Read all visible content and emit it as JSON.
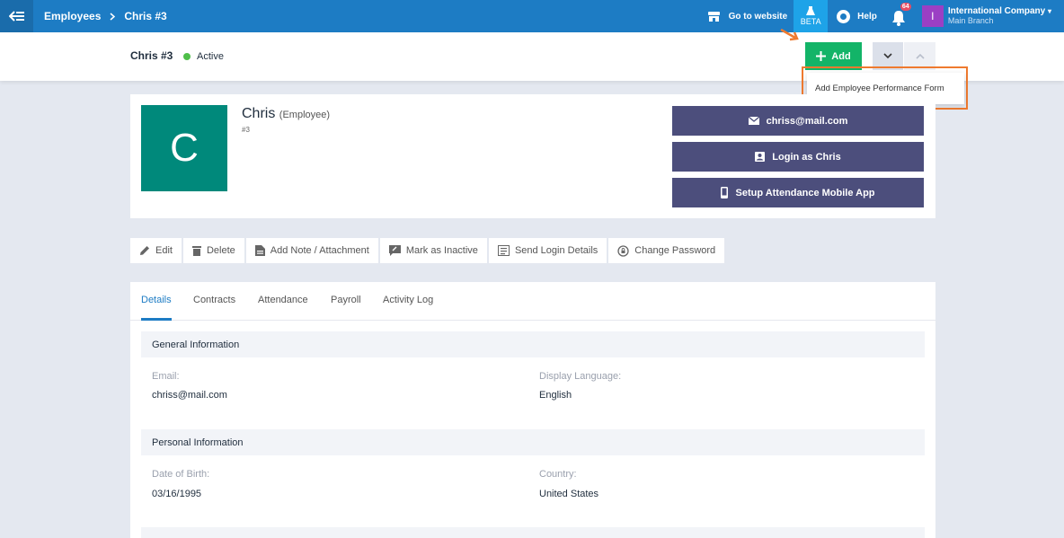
{
  "topbar": {
    "breadcrumb_parent": "Employees",
    "breadcrumb_current": "Chris #3",
    "go_to_website": "Go to website",
    "beta": "BETA",
    "help": "Help",
    "notification_count": "64",
    "company_initial": "I",
    "company_name": "International Company",
    "company_branch": "Main Branch"
  },
  "header": {
    "title": "Chris #3",
    "status": "Active",
    "add_label": "Add",
    "dropdown_item": "Add Employee Performance Form"
  },
  "profile": {
    "avatar_letter": "C",
    "name": "Chris",
    "role": "(Employee)",
    "number": "#3",
    "email_button": "chriss@mail.com",
    "login_button": "Login as Chris",
    "setup_button": "Setup Attendance Mobile App"
  },
  "toolbar": {
    "edit": "Edit",
    "delete": "Delete",
    "add_note": "Add Note / Attachment",
    "mark_inactive": "Mark as Inactive",
    "send_login": "Send Login Details",
    "change_password": "Change Password"
  },
  "tabs": [
    "Details",
    "Contracts",
    "Attendance",
    "Payroll",
    "Activity Log"
  ],
  "details": {
    "general_heading": "General Information",
    "email_label": "Email:",
    "email_value": "chriss@mail.com",
    "language_label": "Display Language:",
    "language_value": "English",
    "personal_heading": "Personal Information",
    "dob_label": "Date of Birth:",
    "dob_value": "03/16/1995",
    "country_label": "Country:",
    "country_value": "United States"
  },
  "colors": {
    "topbar": "#1d7cc4",
    "add_button": "#13b468",
    "action_buttons": "#4c4e7c",
    "avatar": "#00897b",
    "highlight": "#ef7a2f"
  }
}
